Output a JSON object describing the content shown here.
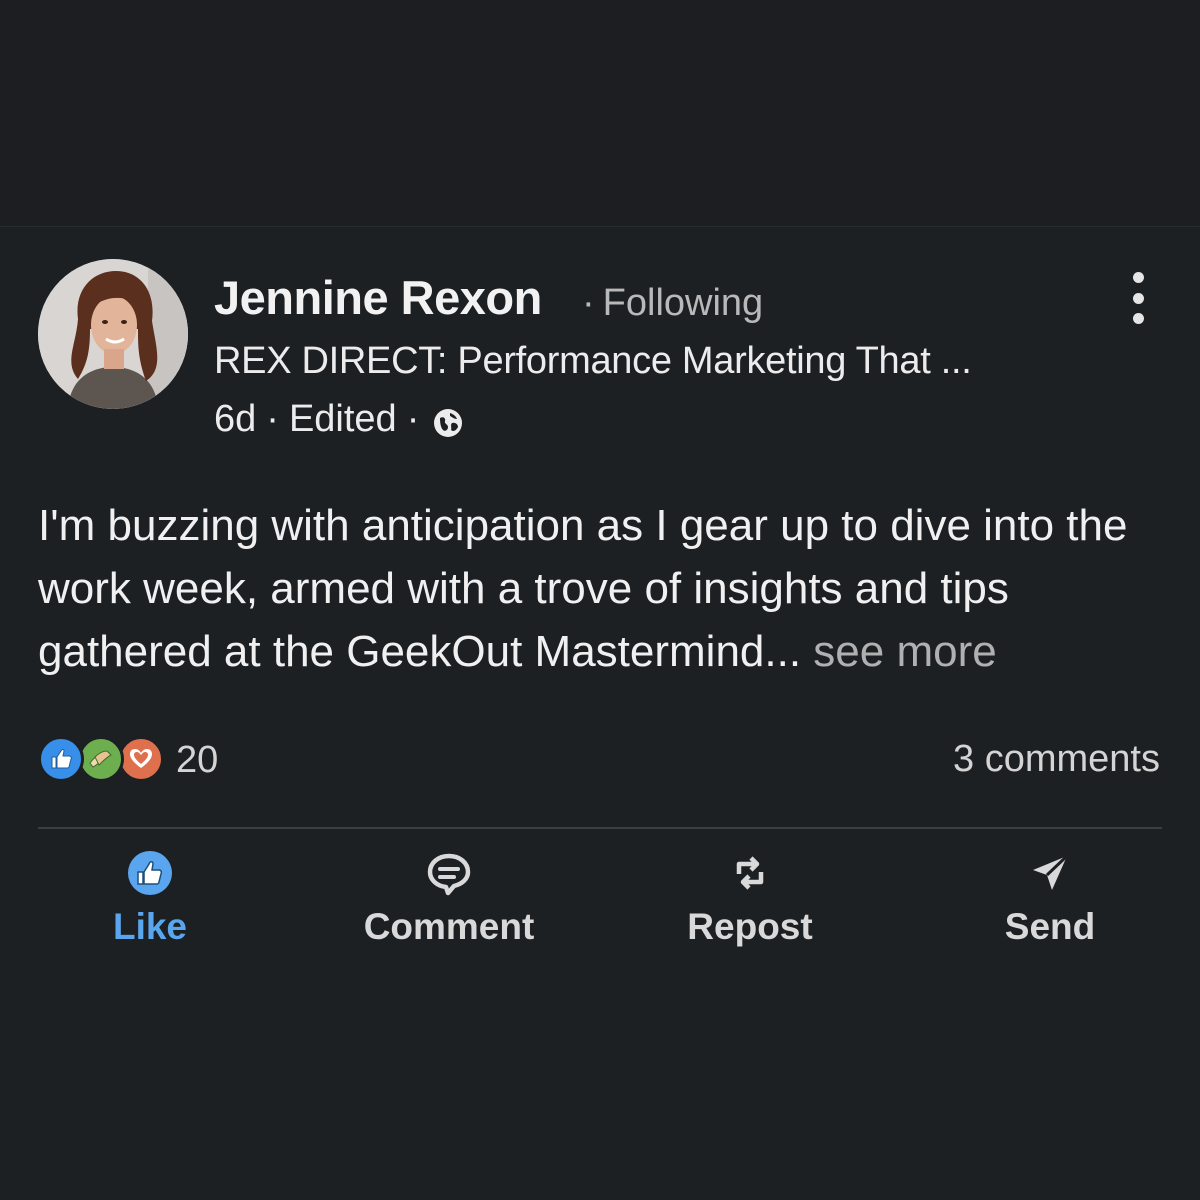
{
  "post": {
    "author": {
      "name": "Jennine Rexon",
      "follow_status": "Following",
      "separator": "·",
      "headline": "REX DIRECT: Performance Marketing That ...",
      "time": "6d",
      "edited": "Edited",
      "visibility_icon": "globe-icon"
    },
    "body": "I'm buzzing with anticipation as I gear up to dive into the work week, armed with a trove of insights and tips gathered at the GeekOut Mastermind...",
    "see_more": " see more",
    "reactions": {
      "icons": [
        "like-reaction-icon",
        "support-reaction-icon",
        "love-reaction-icon"
      ],
      "count": "20"
    },
    "comments": "3 comments"
  },
  "actions": [
    {
      "label": "Like",
      "icon": "thumbs-up-icon"
    },
    {
      "label": "Comment",
      "icon": "comment-icon"
    },
    {
      "label": "Repost",
      "icon": "repost-icon"
    },
    {
      "label": "Send",
      "icon": "send-icon"
    }
  ],
  "colors": {
    "background": "#1d2023",
    "like_active": "#5aa6ee",
    "like_reaction": "#378fe9",
    "support_reaction": "#6dae4f",
    "love_reaction": "#df704d"
  }
}
